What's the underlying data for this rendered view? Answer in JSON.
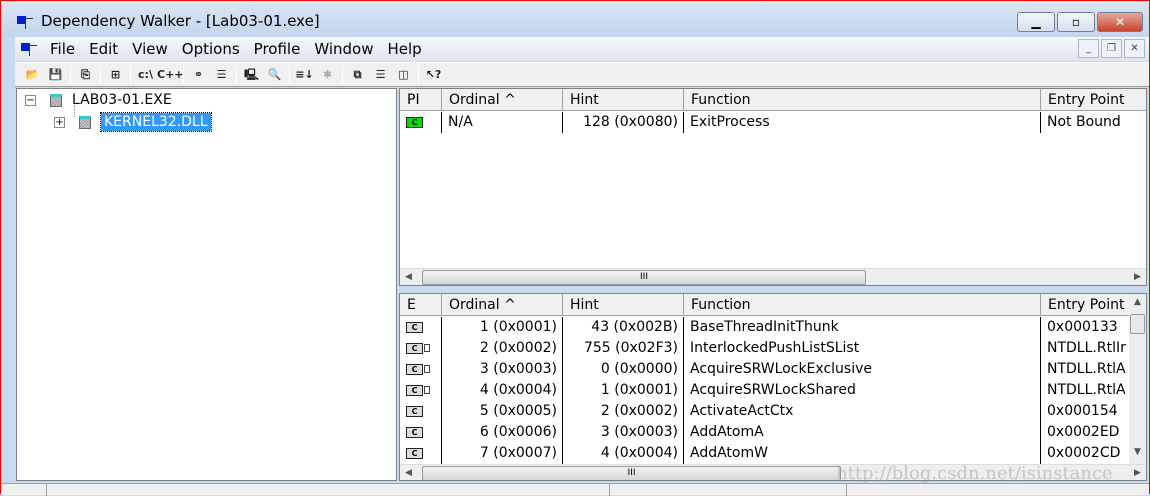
{
  "window": {
    "title": "Dependency Walker - [Lab03-01.exe]",
    "minimize": "▁",
    "maximize": "▫",
    "close": "✕"
  },
  "menu": [
    "File",
    "Edit",
    "View",
    "Options",
    "Profile",
    "Window",
    "Help"
  ],
  "mdi": {
    "minimize": "_",
    "restore": "❐",
    "close": "✕"
  },
  "toolbar": [
    {
      "name": "open-icon",
      "glyph": "📂"
    },
    {
      "name": "save-icon",
      "glyph": "💾"
    },
    {
      "sep": true
    },
    {
      "name": "copy-icon",
      "glyph": "⎘"
    },
    {
      "sep": true
    },
    {
      "name": "tree-icon",
      "glyph": "⊞"
    },
    {
      "sep": true
    },
    {
      "name": "full-paths-icon",
      "glyph": "c:\\"
    },
    {
      "name": "undecorate-cpp-icon",
      "glyph": "C++"
    },
    {
      "sep": true
    },
    {
      "name": "link-icon",
      "glyph": "⚭"
    },
    {
      "name": "properties-icon",
      "glyph": "☰"
    },
    {
      "sep": true
    },
    {
      "name": "system-info-icon",
      "glyph": "🖳"
    },
    {
      "name": "find-icon",
      "glyph": "🔍"
    },
    {
      "sep": true
    },
    {
      "name": "sort-icon",
      "glyph": "≡↓"
    },
    {
      "name": "external-viewer-icon",
      "glyph": "✱",
      "dim": true
    },
    {
      "sep": true
    },
    {
      "name": "cascade-icon",
      "glyph": "⧉"
    },
    {
      "name": "tile-horizontal-icon",
      "glyph": "☰"
    },
    {
      "name": "tile-vertical-icon",
      "glyph": "◫"
    },
    {
      "sep": true
    },
    {
      "name": "help-icon",
      "glyph": "↖?"
    }
  ],
  "tree": [
    {
      "label": "LAB03-01.EXE",
      "expander": "−"
    },
    {
      "label": "KERNEL32.DLL",
      "expander": "+",
      "selected": true
    }
  ],
  "imports": {
    "headers": [
      "PI",
      "Ordinal ^",
      "Hint",
      "Function",
      "Entry Point"
    ],
    "rows": [
      {
        "icon": "C",
        "ordinal": "N/A",
        "hint": "128 (0x0080)",
        "function": "ExitProcess",
        "entry": "Not Bound"
      }
    ]
  },
  "exports": {
    "headers": [
      "E",
      "Ordinal ^",
      "Hint",
      "Function",
      "Entry Point"
    ],
    "rows": [
      {
        "icon": "C",
        "ordinal": "1 (0x0001)",
        "hint": "43 (0x002B)",
        "function": "BaseThreadInitThunk",
        "entry": "0x000133"
      },
      {
        "icon": "C",
        "fwd": true,
        "ordinal": "2 (0x0002)",
        "hint": "755 (0x02F3)",
        "function": "InterlockedPushListSList",
        "entry": "NTDLL.RtlIr"
      },
      {
        "icon": "C",
        "fwd": true,
        "ordinal": "3 (0x0003)",
        "hint": "0 (0x0000)",
        "function": "AcquireSRWLockExclusive",
        "entry": "NTDLL.RtlA"
      },
      {
        "icon": "C",
        "fwd": true,
        "ordinal": "4 (0x0004)",
        "hint": "1 (0x0001)",
        "function": "AcquireSRWLockShared",
        "entry": "NTDLL.RtlA"
      },
      {
        "icon": "C",
        "ordinal": "5 (0x0005)",
        "hint": "2 (0x0002)",
        "function": "ActivateActCtx",
        "entry": "0x000154"
      },
      {
        "icon": "C",
        "ordinal": "6 (0x0006)",
        "hint": "3 (0x0003)",
        "function": "AddAtomA",
        "entry": "0x0002ED"
      },
      {
        "icon": "C",
        "ordinal": "7 (0x0007)",
        "hint": "4 (0x0004)",
        "function": "AddAtomW",
        "entry": "0x0002CD"
      }
    ]
  },
  "scroll_grip": "III",
  "watermark": "http://blog.csdn.net/isinstance"
}
